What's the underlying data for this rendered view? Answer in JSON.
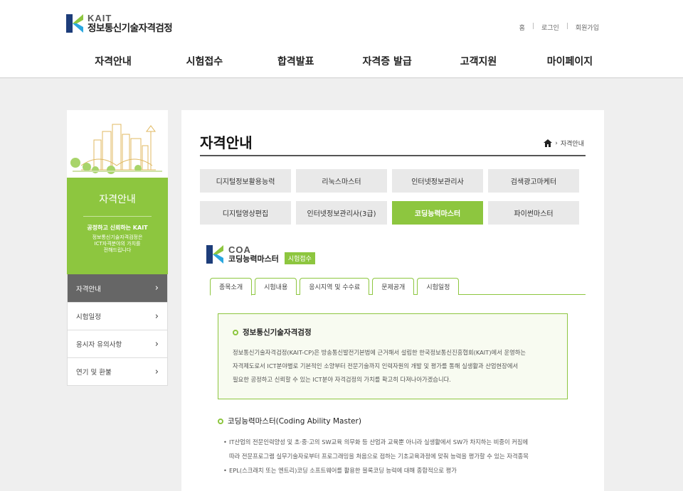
{
  "header": {
    "brand": "KAIT",
    "org_name": "정보통신기술자격검정",
    "util_links": [
      "홈",
      "로그인",
      "회원가입"
    ],
    "gnb": [
      "자격안내",
      "시험접수",
      "합격발표",
      "자격증 발급",
      "고객지원",
      "마이페이지"
    ]
  },
  "sidebar": {
    "title": "자격안내",
    "slogan": "공정하고 신뢰하는 KAIT",
    "desc_line1": "정보통신기술자격검정은",
    "desc_line2": "ICT자격분야의 가치를",
    "desc_line3": "전해드립니다",
    "items": [
      {
        "label": "자격안내"
      },
      {
        "label": "시험일정"
      },
      {
        "label": "응시자 유의사항"
      },
      {
        "label": "연기 및 환불"
      }
    ]
  },
  "content": {
    "page_title": "자격안내",
    "breadcrumb": "자격안내",
    "certs": [
      "디지털정보활용능력",
      "리눅스마스터",
      "인터넷정보관리사",
      "검색광고마케터",
      "디지털영상편집",
      "인터넷정보관리사(3급)",
      "코딩능력마스터",
      "파이썬마스터"
    ],
    "coa_code": "COA",
    "coa_name": "코딩능력마스터",
    "coa_badge": "시험접수",
    "tabs": [
      "종목소개",
      "시험내용",
      "응시지역 및 수수료",
      "문제공개",
      "시험일정"
    ],
    "box_title": "정보통신기술자격검정",
    "box_line1": "정보통신기술자격검정(KAIT-CP)은 방송통신발전기본법에 근거해서 설립한 한국정보통신진흥협회(KAIT)에서 운영하는",
    "box_line2": "자격제도로서 ICT분야별로 기본적인 소양부터 전문기술까지 인력자원의 개발 및 평가를 통해 실생활과 산업현장에서",
    "box_line3": "필요한 공정하고 신뢰할 수 있는 ICT분야 자격검정의 가치를 확고히 다져나아가겠습니다.",
    "sec2_title": "코딩능력마스터(Coding Ability Master)",
    "bullet1_line1": "IT산업의 전문인력양성 및 초·중·고의 SW교육 의무화 등 산업과 교육뿐 아니라 실생활에서 SW가 차지하는 비중이 커짐에",
    "bullet1_line2": "따라 전문프로그램 실무기술자로부터 프로그래밍을 처음으로 접하는 기초교육과정에 맞춰 능력을 평가할 수 있는 자격종목",
    "bullet2": "EPL(스크래치 또는 엔트리)코딩 소프트웨어를 활용한 블록코딩 능력에 대해 종합적으로 평가"
  },
  "colors": {
    "accent_green": "#8dc63f",
    "active_side": "#666666",
    "logo_blue": "#1d3d7a"
  }
}
